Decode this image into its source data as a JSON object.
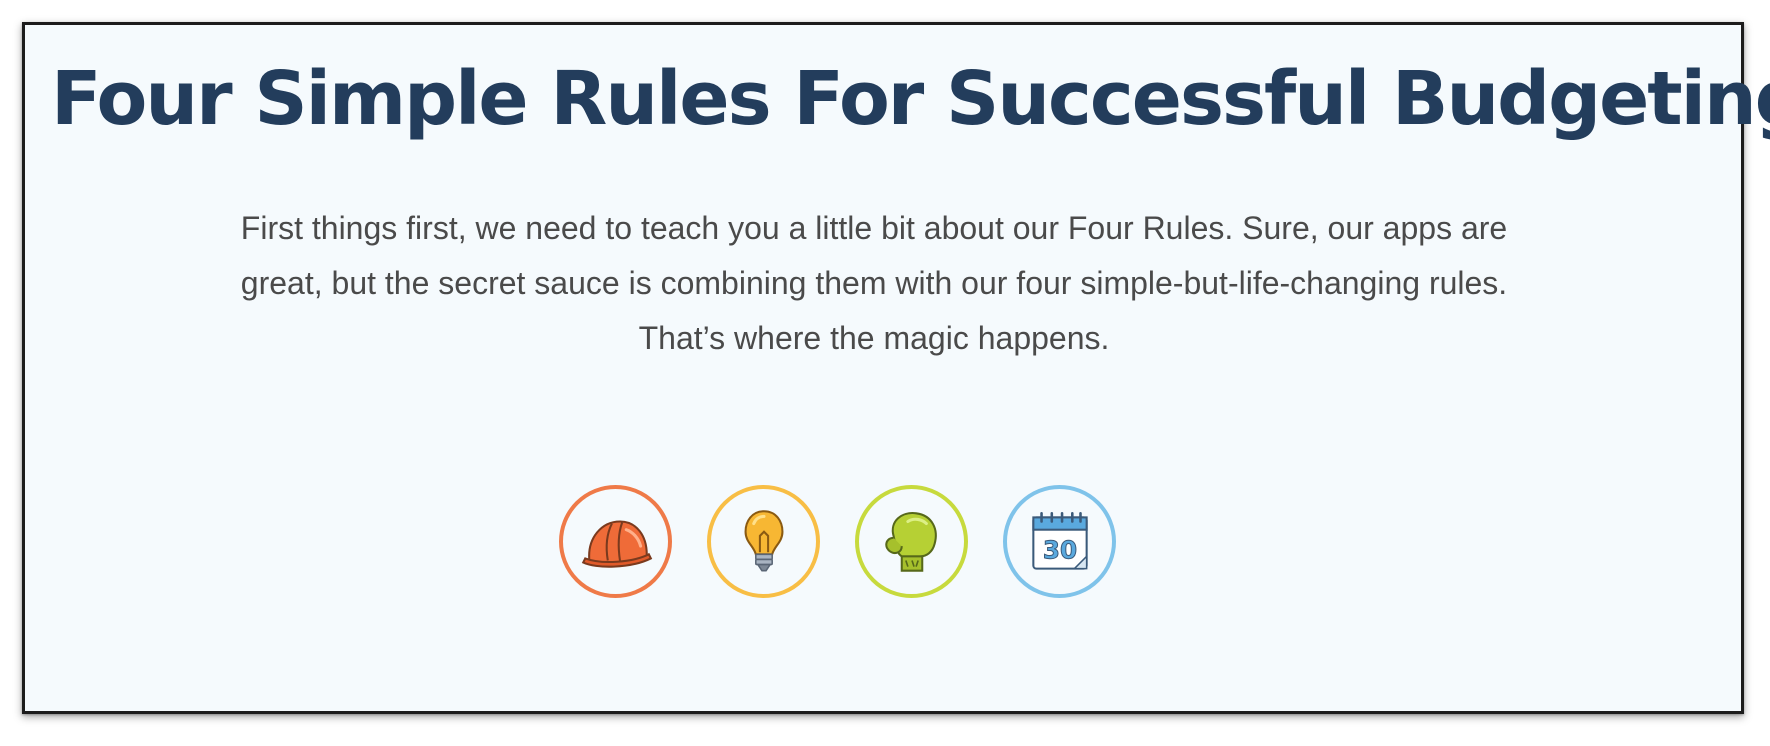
{
  "page": {
    "title": "Four Simple Rules For Successful Budgeting",
    "intro": "First things first, we need to teach you a little bit about our Four Rules. Sure, our apps are great, but the secret sauce is combining them with our four simple-but-life-changing rules. That’s where the magic happens."
  },
  "rules": [
    {
      "icon": "hard-hat-icon",
      "ring_color": "#ef7a48"
    },
    {
      "icon": "light-bulb-icon",
      "ring_color": "#f8be45"
    },
    {
      "icon": "boxing-glove-icon",
      "ring_color": "#c7da3d"
    },
    {
      "icon": "calendar-icon",
      "ring_color": "#7fc3ea",
      "label": "30"
    }
  ],
  "colors": {
    "title": "#233d5c",
    "body_text": "#4a4a4a",
    "panel_background": "#f5fafd"
  }
}
